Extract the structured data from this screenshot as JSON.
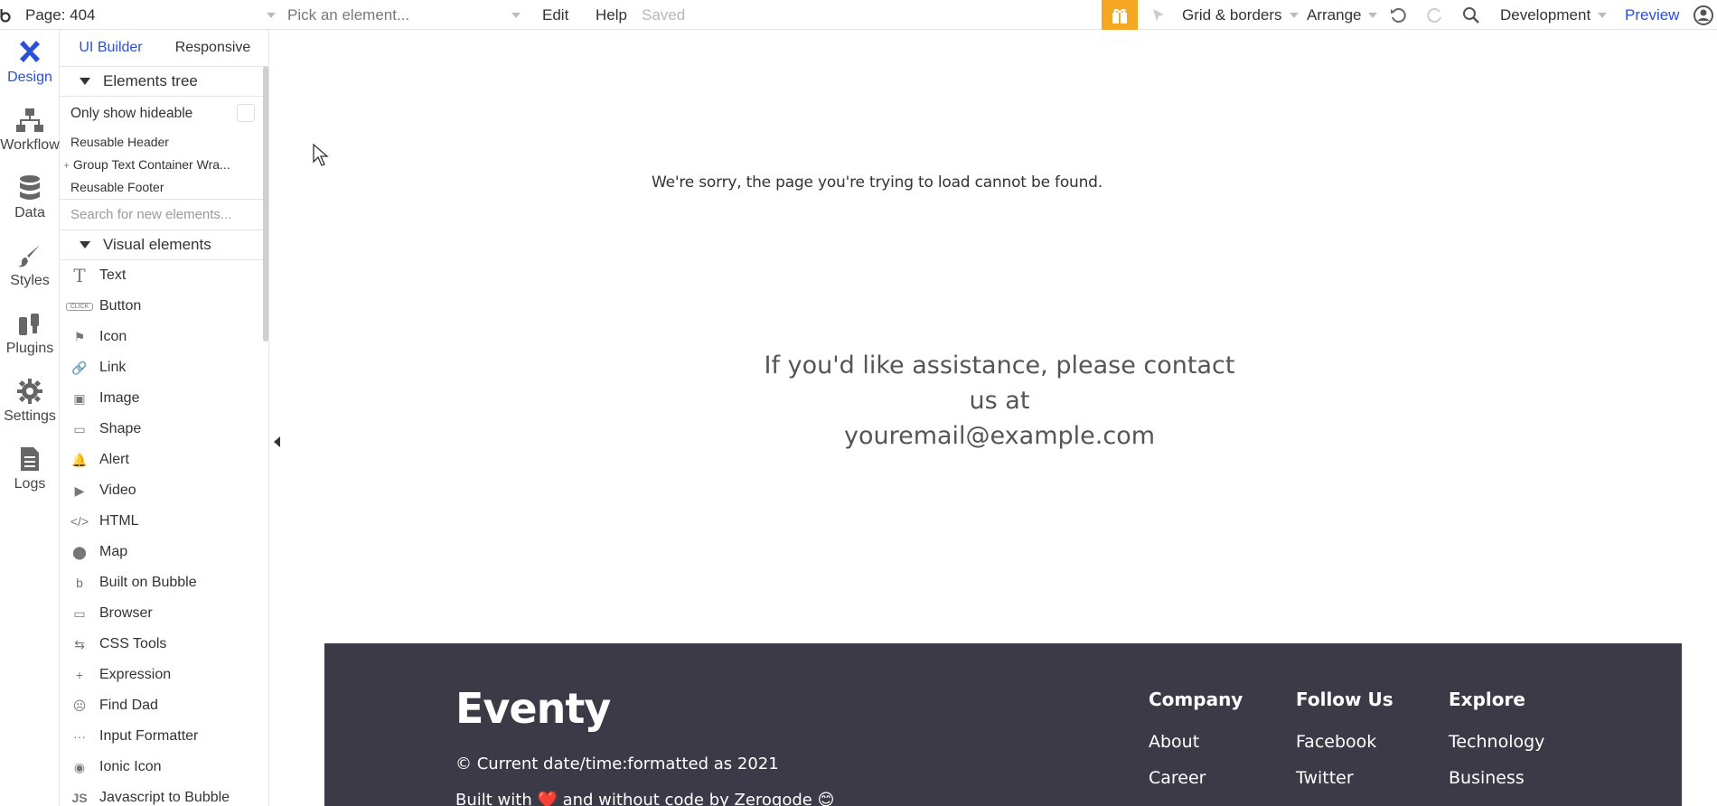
{
  "topbar": {
    "page_label": "Page: 404",
    "element_picker_placeholder": "Pick an element...",
    "edit": "Edit",
    "help": "Help",
    "saved": "Saved",
    "grid_borders": "Grid & borders",
    "arrange": "Arrange",
    "environment": "Development",
    "preview": "Preview"
  },
  "rail": {
    "items": [
      {
        "label": "Design",
        "icon": "design-icon"
      },
      {
        "label": "Workflow",
        "icon": "workflow-icon"
      },
      {
        "label": "Data",
        "icon": "data-icon"
      },
      {
        "label": "Styles",
        "icon": "styles-icon"
      },
      {
        "label": "Plugins",
        "icon": "plugins-icon"
      },
      {
        "label": "Settings",
        "icon": "settings-icon"
      },
      {
        "label": "Logs",
        "icon": "logs-icon"
      }
    ]
  },
  "panel": {
    "tabs": [
      "UI Builder",
      "Responsive"
    ],
    "elements_tree_title": "Elements tree",
    "only_show_hideable": "Only show hideable",
    "tree_items": [
      "Reusable Header",
      "Group Text Container Wra...",
      "Reusable Footer"
    ],
    "search_placeholder": "Search for new elements...",
    "visual_elements_title": "Visual elements",
    "visual_elements": [
      {
        "label": "Text",
        "icon": "T"
      },
      {
        "label": "Button",
        "icon": "CLICK"
      },
      {
        "label": "Icon",
        "icon": "⚑"
      },
      {
        "label": "Link",
        "icon": "🔗"
      },
      {
        "label": "Image",
        "icon": "▣"
      },
      {
        "label": "Shape",
        "icon": "▭"
      },
      {
        "label": "Alert",
        "icon": "🔔"
      },
      {
        "label": "Video",
        "icon": "▶"
      },
      {
        "label": "HTML",
        "icon": "</>"
      },
      {
        "label": "Map",
        "icon": "⬤"
      },
      {
        "label": "Built on Bubble",
        "icon": "b"
      },
      {
        "label": "Browser",
        "icon": "▭"
      },
      {
        "label": "CSS Tools",
        "icon": "⇆"
      },
      {
        "label": "Expression",
        "icon": "+"
      },
      {
        "label": "Find Dad",
        "icon": "☹"
      },
      {
        "label": "Input Formatter",
        "icon": "···"
      },
      {
        "label": "Ionic Icon",
        "icon": "◉"
      },
      {
        "label": "Javascript to Bubble",
        "icon": "JS"
      }
    ]
  },
  "canvas": {
    "sorry_text": "We're sorry, the page you're trying to load cannot be found.",
    "assist_line1": "If you'd like assistance, please contact us at",
    "assist_line2": "youremail@example.com"
  },
  "footer": {
    "brand": "Eventy",
    "copyright": "© Current date/time:formatted as  2021",
    "built_with": "Built with ❤️ and without code by Zeroqode 😊",
    "columns": [
      {
        "title": "Company",
        "items": [
          "About",
          "Career"
        ]
      },
      {
        "title": "Follow Us",
        "items": [
          "Facebook",
          "Twitter"
        ]
      },
      {
        "title": "Explore",
        "items": [
          "Technology",
          "Business"
        ]
      }
    ]
  },
  "colors": {
    "accent": "#2b4fd6",
    "gift": "#f5a623",
    "footer_bg": "#3d3a47"
  }
}
